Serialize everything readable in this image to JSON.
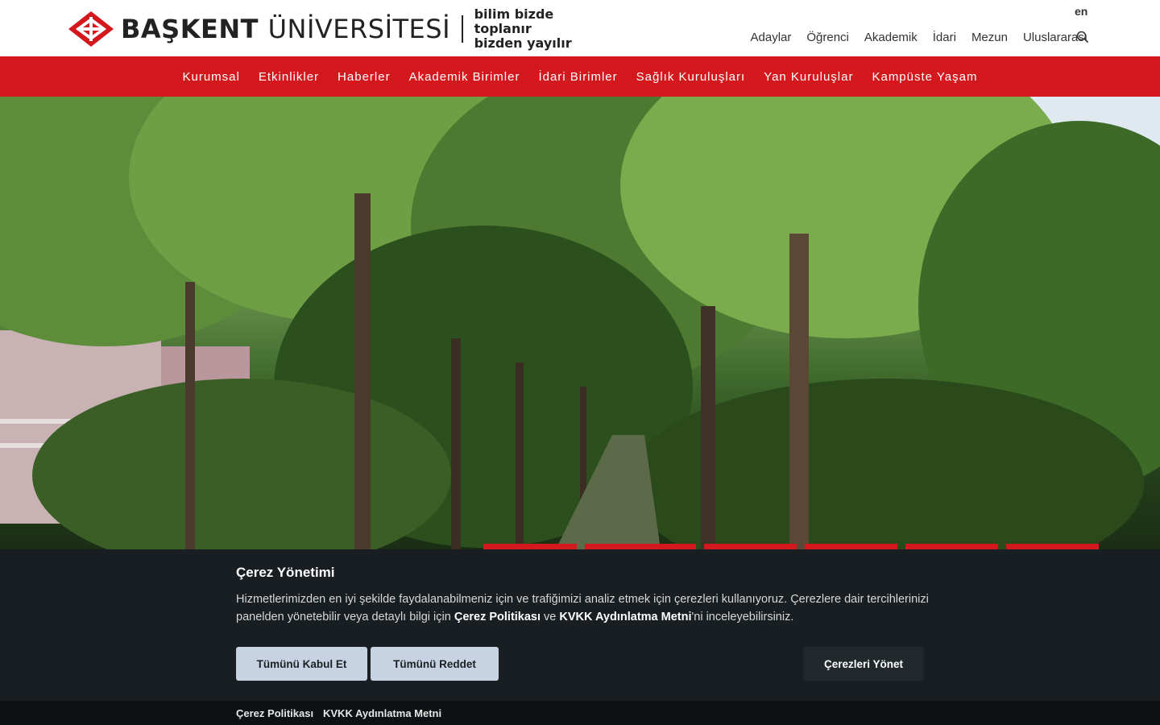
{
  "header": {
    "logo_name_bold": "BAŞKENT",
    "logo_name_light": "ÜNİVERSİTESİ",
    "slogan_line1": "bilim bizde toplanır",
    "slogan_line2": "bizden yayılır",
    "lang": "en",
    "top_links": [
      "Adaylar",
      "Öğrenci",
      "Akademik",
      "İdari",
      "Mezun",
      "Uluslararası"
    ]
  },
  "main_nav": [
    "Kurumsal",
    "Etkinlikler",
    "Haberler",
    "Akademik Birimler",
    "İdari Birimler",
    "Sağlık Kuruluşları",
    "Yan Kuruluşlar",
    "Kampüste Yaşam"
  ],
  "cookie": {
    "title": "Çerez Yönetimi",
    "text_part1": "Hizmetlerimizden en iyi şekilde faydalanabilmeniz için ve trafiğimizi analiz etmek için çerezleri kullanıyoruz. Çerezlere dair tercihlerinizi panelden yönetebilir veya detaylı bilgi için ",
    "policy_link": "Çerez Politikası",
    "text_part2": " ve ",
    "kvkk_link": "KVKK Aydınlatma Metni",
    "text_part3": "'ni inceleyebilirsiniz.",
    "accept_all": "Tümünü Kabul Et",
    "reject_all": "Tümünü Reddet",
    "manage": "Çerezleri Yönet",
    "footer_policy": "Çerez Politikası",
    "footer_kvkk": "KVKK Aydınlatma Metni"
  },
  "colors": {
    "brand_red": "#d3181e",
    "banner_bg": "#181e21"
  },
  "icons": {
    "search": "search-icon",
    "logo": "logo-mark-icon"
  }
}
